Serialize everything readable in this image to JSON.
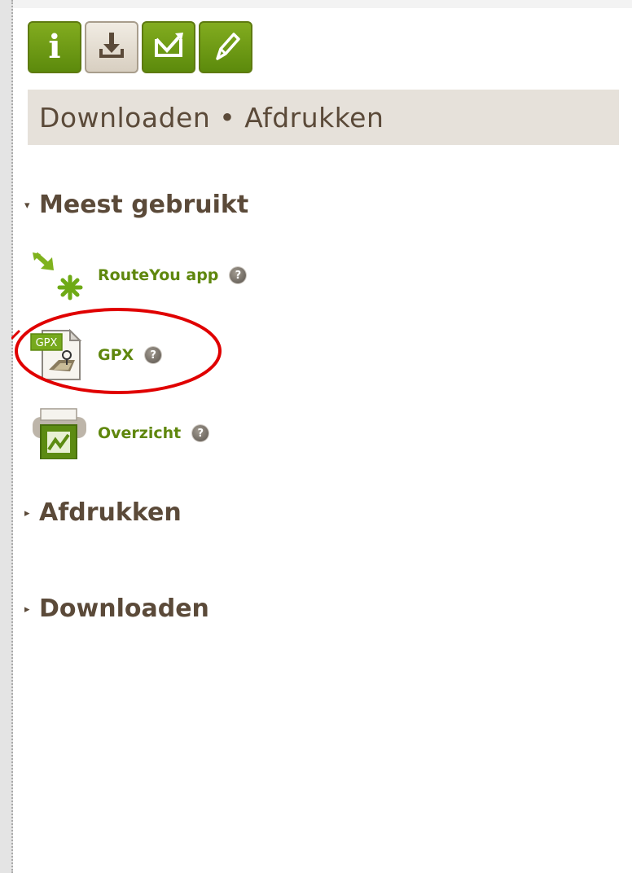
{
  "toolbar": {
    "buttons": [
      {
        "icon": "info-icon",
        "active": false
      },
      {
        "icon": "download-icon",
        "active": true
      },
      {
        "icon": "share-icon",
        "active": false
      },
      {
        "icon": "pencil-icon",
        "active": false
      }
    ],
    "info_glyph": "i"
  },
  "header": {
    "title": "Downloaden • Afdrukken"
  },
  "sections": {
    "most_used": {
      "label": "Meest gebruikt",
      "arrow": "▾",
      "expanded": true
    },
    "afdrukken": {
      "label": "Afdrukken",
      "arrow": "▸",
      "expanded": false
    },
    "downloaden": {
      "label": "Downloaden",
      "arrow": "▸",
      "expanded": false
    }
  },
  "items": {
    "routeyou": {
      "label": "RouteYou app",
      "icon": "routeyou-app-icon"
    },
    "gpx": {
      "label": "GPX",
      "icon": "gpx-file-icon",
      "icon_text": "GPX"
    },
    "overzicht": {
      "label": "Overzicht",
      "icon": "printer-icon"
    }
  },
  "help_glyph": "?",
  "colors": {
    "brand_green": "#6f9a14",
    "text_brown": "#5b4a39",
    "link_green": "#5f870d",
    "annotation_red": "#e00000"
  }
}
